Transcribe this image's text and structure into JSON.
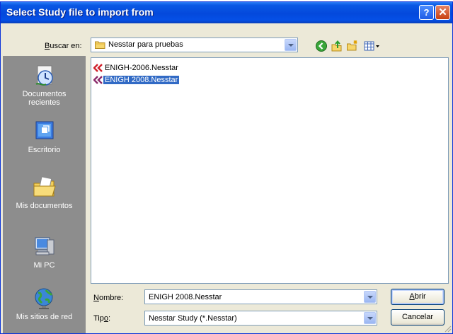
{
  "window": {
    "title": "Select Study file to import from",
    "help_button": "?",
    "close_button": "✕"
  },
  "lookin": {
    "label_accel": "B",
    "label_rest": "uscar en:",
    "value": "Nesstar para pruebas"
  },
  "places": [
    {
      "label_line1": "Documentos",
      "label_line2": "recientes",
      "icon": "recent-documents-icon"
    },
    {
      "label_line1": "Escritorio",
      "label_line2": "",
      "icon": "desktop-icon"
    },
    {
      "label_line1": "Mis documentos",
      "label_line2": "",
      "icon": "my-documents-icon"
    },
    {
      "label_line1": "Mi PC",
      "label_line2": "",
      "icon": "my-computer-icon"
    },
    {
      "label_line1": "Mis sitios de red",
      "label_line2": "",
      "icon": "network-places-icon"
    }
  ],
  "files": [
    {
      "name": "ENIGH-2006.Nesstar",
      "selected": false
    },
    {
      "name": "ENIGH 2008.Nesstar",
      "selected": true
    }
  ],
  "filename": {
    "label_accel": "N",
    "label_rest": "ombre:",
    "value": "ENIGH 2008.Nesstar"
  },
  "filetype": {
    "label_pre": "Tip",
    "label_accel": "o",
    "label_rest": ":",
    "value": "Nesstar Study (*.Nesstar)"
  },
  "buttons": {
    "open_accel": "A",
    "open_rest": "brir",
    "cancel": "Cancelar"
  },
  "colors": {
    "titlebar": "#0449dc",
    "places_bg": "#8d8d8d",
    "selection": "#316ac5"
  }
}
